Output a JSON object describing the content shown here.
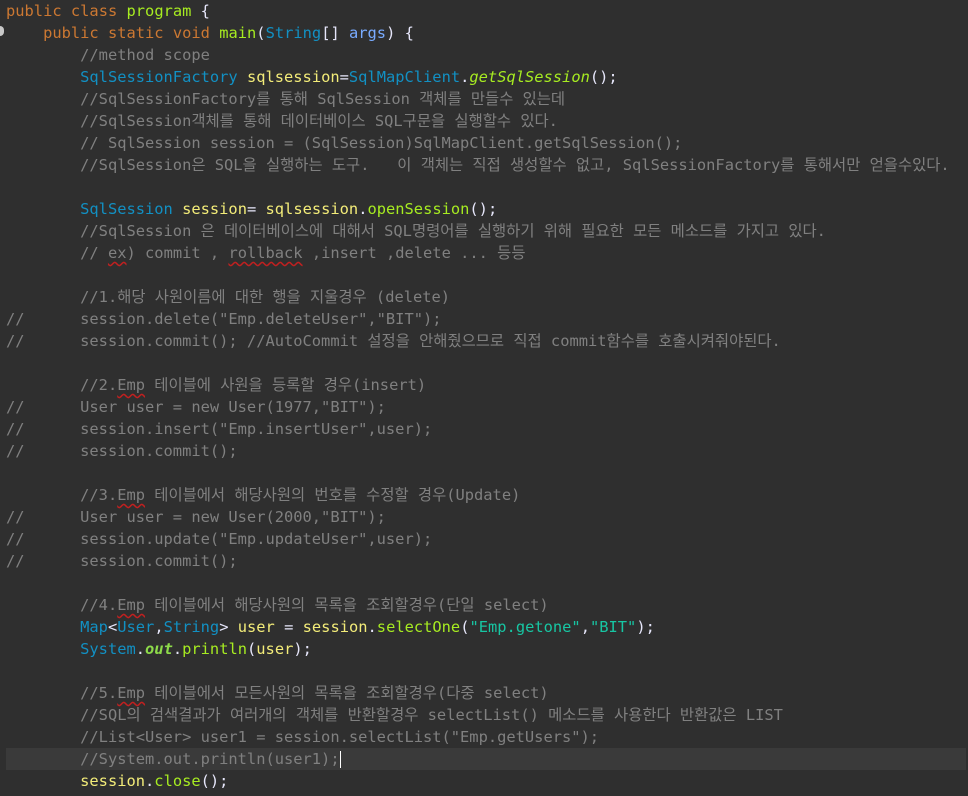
{
  "editor": {
    "lines": [
      {
        "indent": "",
        "tokens": [
          [
            "kw",
            "public"
          ],
          [
            "plain",
            " "
          ],
          [
            "kw",
            "class"
          ],
          [
            "plain",
            " "
          ],
          [
            "name",
            "program"
          ],
          [
            "plain",
            " {"
          ]
        ]
      },
      {
        "indent": "    ",
        "tokens": [
          [
            "kw",
            "public"
          ],
          [
            "plain",
            " "
          ],
          [
            "kw",
            "static"
          ],
          [
            "plain",
            " "
          ],
          [
            "kw",
            "void"
          ],
          [
            "plain",
            " "
          ],
          [
            "name",
            "main"
          ],
          [
            "plain",
            "("
          ],
          [
            "cls",
            "String"
          ],
          [
            "plain",
            "[] "
          ],
          [
            "var2",
            "args"
          ],
          [
            "plain",
            ") {"
          ]
        ]
      },
      {
        "indent": "        ",
        "tokens": [
          [
            "com",
            "//method scope"
          ]
        ]
      },
      {
        "indent": "        ",
        "tokens": [
          [
            "cls",
            "SqlSessionFactory"
          ],
          [
            "plain",
            " "
          ],
          [
            "var",
            "sqlsession"
          ],
          [
            "plain",
            "="
          ],
          [
            "cls",
            "SqlMapClient"
          ],
          [
            "plain",
            "."
          ],
          [
            "mital",
            "getSqlSession"
          ],
          [
            "plain",
            "();"
          ]
        ]
      },
      {
        "indent": "        ",
        "tokens": [
          [
            "com",
            "//SqlSessionFactory를 통해 SqlSession 객체를 만들수 있는데"
          ]
        ]
      },
      {
        "indent": "        ",
        "tokens": [
          [
            "com",
            "//SqlSession객체를 통해 데이터베이스 SQL구문을 실행할수 있다."
          ]
        ]
      },
      {
        "indent": "        ",
        "tokens": [
          [
            "com",
            "// SqlSession session = (SqlSession)SqlMapClient.getSqlSession();"
          ]
        ]
      },
      {
        "indent": "        ",
        "tokens": [
          [
            "com",
            "//SqlSession은 SQL을 실행하는 도구.   이 객체는 직접 생성할수 없고, SqlSessionFactory를 통해서만 얻을수있다."
          ]
        ]
      },
      {
        "indent": "",
        "tokens": []
      },
      {
        "indent": "        ",
        "tokens": [
          [
            "cls",
            "SqlSession"
          ],
          [
            "plain",
            " "
          ],
          [
            "var",
            "session"
          ],
          [
            "plain",
            "= "
          ],
          [
            "var",
            "sqlsession"
          ],
          [
            "plain",
            "."
          ],
          [
            "mname",
            "openSession"
          ],
          [
            "plain",
            "();"
          ]
        ]
      },
      {
        "indent": "        ",
        "tokens": [
          [
            "com",
            "//SqlSession 은 데이터베이스에 대해서 SQL명령어를 실행하기 위해 필요한 모든 메소드를 가지고 있다."
          ]
        ]
      },
      {
        "indent": "        ",
        "tokens": [
          [
            "com",
            "// "
          ],
          [
            "comwavy",
            "ex"
          ],
          [
            "com",
            ") commit , "
          ],
          [
            "comwavy",
            "rollback"
          ],
          [
            "com",
            " ,insert ,delete ... 등등"
          ]
        ]
      },
      {
        "indent": "",
        "tokens": []
      },
      {
        "indent": "        ",
        "tokens": [
          [
            "com",
            "//1.해당 사원이름에 대한 행을 지울경우 (delete)"
          ]
        ]
      },
      {
        "indent": "//      ",
        "tokens": [
          [
            "com",
            "session.delete(\"Emp.deleteUser\",\"BIT\");"
          ]
        ]
      },
      {
        "indent": "//      ",
        "tokens": [
          [
            "com",
            "session.commit(); //AutoCommit 설정을 안해줬으므로 직접 commit함수를 호출시켜줘야된다."
          ]
        ]
      },
      {
        "indent": "",
        "tokens": []
      },
      {
        "indent": "        ",
        "tokens": [
          [
            "com",
            "//2."
          ],
          [
            "comwavy",
            "Emp"
          ],
          [
            "com",
            " 테이블에 사원을 등록할 경우(insert)"
          ]
        ]
      },
      {
        "indent": "//      ",
        "tokens": [
          [
            "com",
            "User user = new User(1977,\"BIT\");"
          ]
        ]
      },
      {
        "indent": "//      ",
        "tokens": [
          [
            "com",
            "session.insert(\"Emp.insertUser\",user);"
          ]
        ]
      },
      {
        "indent": "//      ",
        "tokens": [
          [
            "com",
            "session.commit();"
          ]
        ]
      },
      {
        "indent": "",
        "tokens": []
      },
      {
        "indent": "        ",
        "tokens": [
          [
            "com",
            "//3."
          ],
          [
            "comwavy",
            "Emp"
          ],
          [
            "com",
            " 테이블에서 해당사원의 번호를 수정할 경우(Update)"
          ]
        ]
      },
      {
        "indent": "//      ",
        "tokens": [
          [
            "com",
            "User user = new User(2000,\"BIT\");"
          ]
        ]
      },
      {
        "indent": "//      ",
        "tokens": [
          [
            "com",
            "session.update(\"Emp.updateUser\",user);"
          ]
        ]
      },
      {
        "indent": "//      ",
        "tokens": [
          [
            "com",
            "session.commit();"
          ]
        ]
      },
      {
        "indent": "",
        "tokens": []
      },
      {
        "indent": "        ",
        "tokens": [
          [
            "com",
            "//4."
          ],
          [
            "comwavy",
            "Emp"
          ],
          [
            "com",
            " 테이블에서 해당사원의 목록을 조회할경우(단일 select)"
          ]
        ]
      },
      {
        "indent": "        ",
        "tokens": [
          [
            "cls",
            "Map"
          ],
          [
            "plain",
            "<"
          ],
          [
            "cls",
            "User"
          ],
          [
            "plain",
            ","
          ],
          [
            "cls",
            "String"
          ],
          [
            "plain",
            "> "
          ],
          [
            "var",
            "user"
          ],
          [
            "plain",
            " = "
          ],
          [
            "var",
            "session"
          ],
          [
            "plain",
            "."
          ],
          [
            "mname",
            "selectOne"
          ],
          [
            "plain",
            "("
          ],
          [
            "str",
            "\"Emp.getone\""
          ],
          [
            "plain",
            ","
          ],
          [
            "str",
            "\"BIT\""
          ],
          [
            "plain",
            ");"
          ]
        ]
      },
      {
        "indent": "        ",
        "tokens": [
          [
            "cls",
            "System"
          ],
          [
            "plain",
            "."
          ],
          [
            "fld",
            "out"
          ],
          [
            "plain",
            "."
          ],
          [
            "mname",
            "println"
          ],
          [
            "plain",
            "("
          ],
          [
            "var",
            "user"
          ],
          [
            "plain",
            ");"
          ]
        ]
      },
      {
        "indent": "",
        "tokens": []
      },
      {
        "indent": "        ",
        "tokens": [
          [
            "com",
            "//5."
          ],
          [
            "comwavy",
            "Emp"
          ],
          [
            "com",
            " 테이블에서 모든사원의 목록을 조회할경우(다중 select)"
          ]
        ]
      },
      {
        "indent": "        ",
        "tokens": [
          [
            "com",
            "//SQL의 검색결과가 여러개의 객체를 반환할경우 selectList() 메소드를 사용한다 반환값은 LIST"
          ]
        ]
      },
      {
        "indent": "        ",
        "tokens": [
          [
            "com",
            "//List<User> user1 = session.selectList(\"Emp.getUsers\");"
          ]
        ]
      },
      {
        "indent": "        ",
        "tokens": [
          [
            "com",
            "//System.out.println(user1);"
          ]
        ],
        "caret": true,
        "highlight": true
      },
      {
        "indent": "        ",
        "tokens": [
          [
            "var",
            "session"
          ],
          [
            "plain",
            "."
          ],
          [
            "mname",
            "close"
          ],
          [
            "plain",
            "();"
          ]
        ]
      }
    ]
  },
  "colors": {
    "background": "#2f2f2f",
    "keyword": "#cc7832",
    "type": "#1290c3",
    "method": "#a7ec21",
    "string": "#17c6a3",
    "comment": "#808080",
    "variable": "#f3ec79",
    "field": "#8dda4a"
  }
}
